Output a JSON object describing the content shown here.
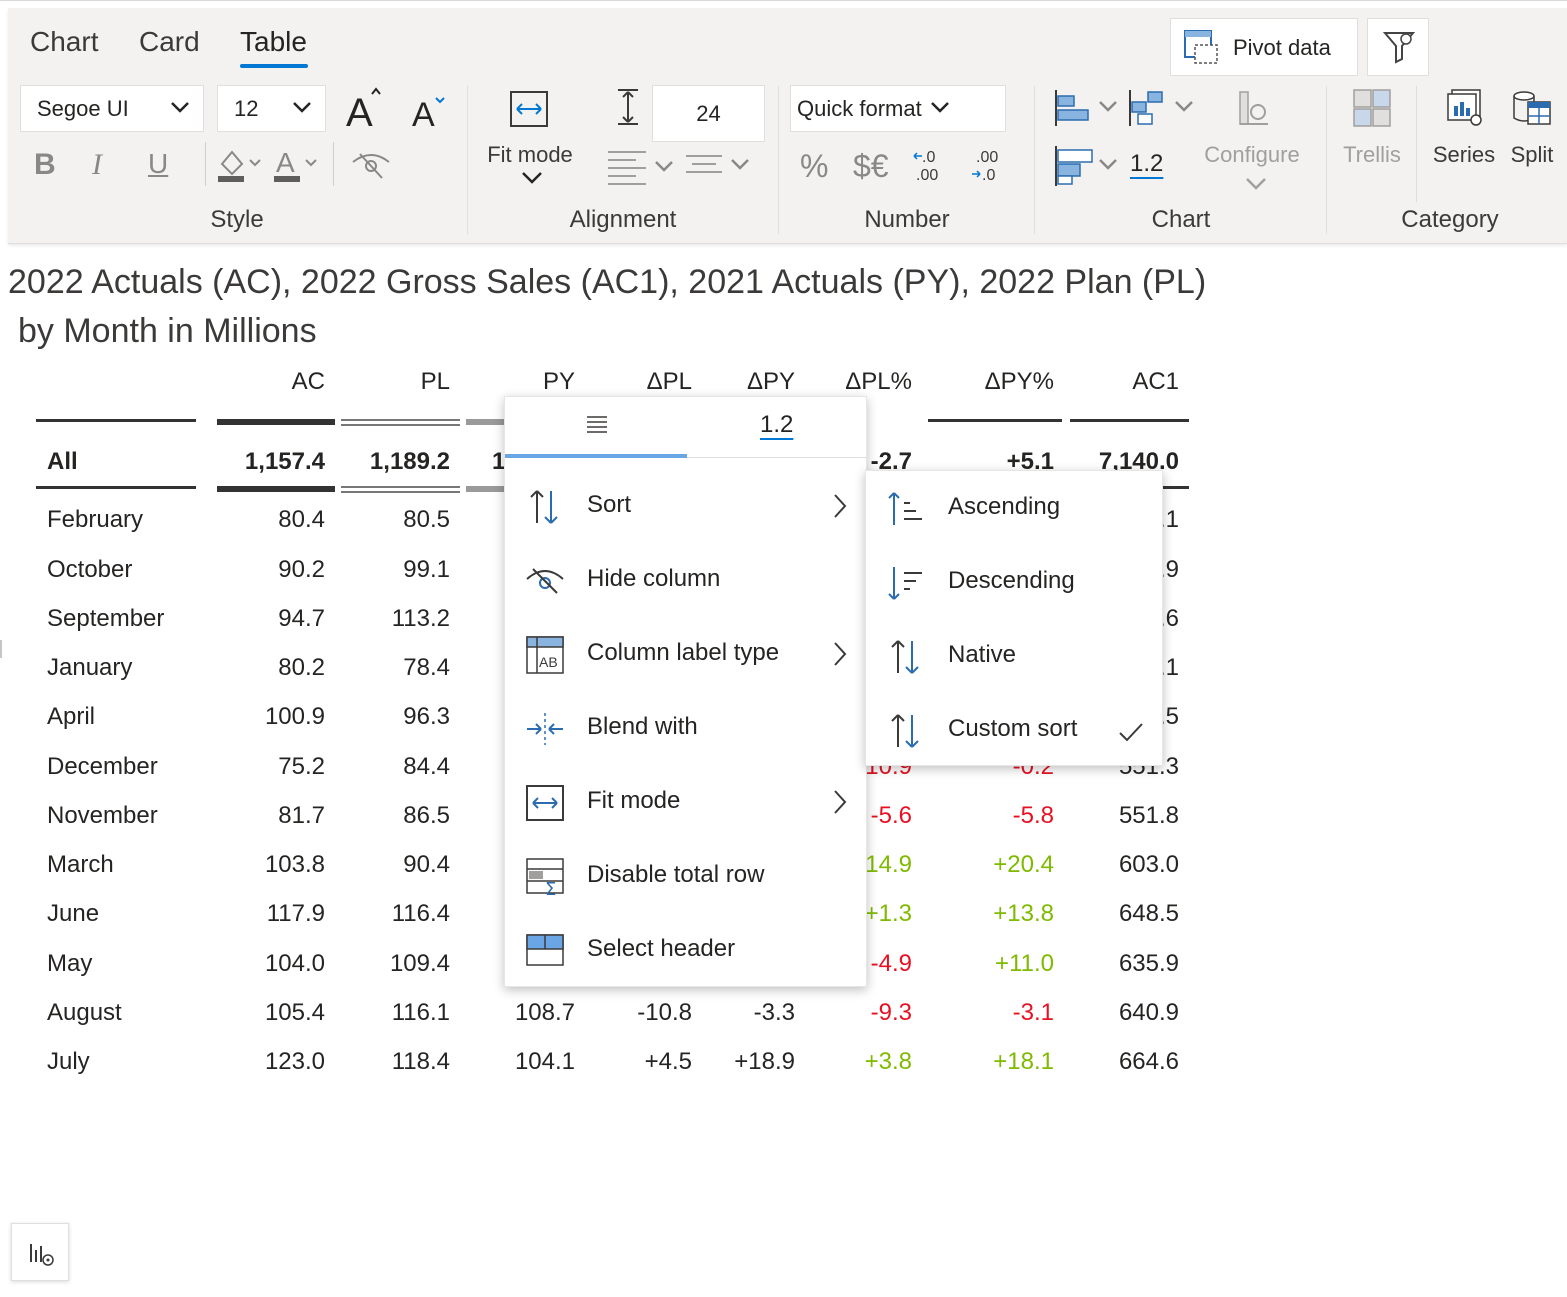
{
  "tabs": [
    {
      "label": "Chart"
    },
    {
      "label": "Card"
    },
    {
      "label": "Table"
    }
  ],
  "header_buttons": {
    "pivot_label": "Pivot data"
  },
  "style": {
    "font_family_value": "Segoe UI",
    "font_size_value": "12",
    "group_label": "Style",
    "bold": "B",
    "italic": "I",
    "underline": "U"
  },
  "alignment": {
    "fit_mode_label": "Fit mode",
    "row_height_value": "24",
    "group_label": "Alignment"
  },
  "number": {
    "quick_format_label": "Quick format",
    "percent": "%",
    "currency": "$€",
    "group_label": "Number"
  },
  "chart_group": {
    "value_label": "1.2",
    "configure_label": "Configure",
    "group_label": "Chart"
  },
  "category": {
    "trellis_label": "Trellis",
    "series_label": "Series",
    "split_label": "Split",
    "group_label": "Category"
  },
  "title_line1": "2022 Actuals (AC), 2022 Gross Sales (AC1), 2021 Actuals (PY), 2022 Plan (PL)",
  "title_line2": "by Month in Millions",
  "table": {
    "columns": [
      "AC",
      "PL",
      "PY",
      "ΔPL",
      "ΔPY",
      "ΔPL%",
      "ΔPY%",
      "AC1"
    ],
    "total": {
      "label": "All",
      "AC": "1,157.4",
      "PL": "1,189.2",
      "PY": "1",
      "dPLpct": "-2.7",
      "dPYpct": "+5.1",
      "AC1": "7,140.0"
    },
    "rows": [
      {
        "label": "February",
        "AC": "80.4",
        "PL": "80.5",
        "AC1": ".1"
      },
      {
        "label": "October",
        "AC": "90.2",
        "PL": "99.1",
        "AC1": ".9"
      },
      {
        "label": "September",
        "AC": "94.7",
        "PL": "113.2",
        "AC1": ".6"
      },
      {
        "label": "January",
        "AC": "80.2",
        "PL": "78.4",
        "AC1": ".1"
      },
      {
        "label": "April",
        "AC": "100.9",
        "PL": "96.3",
        "AC1": ".5"
      },
      {
        "label": "December",
        "AC": "75.2",
        "PL": "84.4",
        "dPLpct": "10.9",
        "dPYpct": "-0.2",
        "AC1": "551.3"
      },
      {
        "label": "November",
        "AC": "81.7",
        "PL": "86.5",
        "dPLpct": "-5.6",
        "dPYpct": "-5.8",
        "AC1": "551.8"
      },
      {
        "label": "March",
        "AC": "103.8",
        "PL": "90.4",
        "dPLpct": "14.9",
        "dPYpct": "+20.4",
        "AC1": "603.0"
      },
      {
        "label": "June",
        "AC": "117.9",
        "PL": "116.4",
        "dPLpct": "+1.3",
        "dPYpct": "+13.8",
        "AC1": "648.5"
      },
      {
        "label": "May",
        "AC": "104.0",
        "PL": "109.4",
        "dPLpct": "-4.9",
        "dPYpct": "+11.0",
        "AC1": "635.9"
      },
      {
        "label": "August",
        "AC": "105.4",
        "PL": "116.1",
        "PY": "108.7",
        "dPL": "-10.8",
        "dPY": "-3.3",
        "dPLpct": "-9.3",
        "dPYpct": "-3.1",
        "AC1": "640.9"
      },
      {
        "label": "July",
        "AC": "123.0",
        "PL": "118.4",
        "PY": "104.1",
        "dPL": "+4.5",
        "dPY": "+18.9",
        "dPLpct": "+3.8",
        "dPYpct": "+18.1",
        "AC1": "664.6"
      }
    ]
  },
  "context_menu": {
    "tab_value_label": "1.2",
    "items": [
      {
        "label": "Sort"
      },
      {
        "label": "Hide column"
      },
      {
        "label": "Column label type"
      },
      {
        "label": "Blend with"
      },
      {
        "label": "Fit mode"
      },
      {
        "label": "Disable total row"
      },
      {
        "label": "Select header"
      }
    ]
  },
  "sort_submenu": {
    "items": [
      {
        "label": "Ascending"
      },
      {
        "label": "Descending"
      },
      {
        "label": "Native"
      },
      {
        "label": "Custom sort",
        "checked": true
      }
    ]
  },
  "colors": {
    "accent": "#0078d4",
    "negative": "#e81123",
    "positive": "#7fba00",
    "icon_blue": "#2b6cb0"
  }
}
